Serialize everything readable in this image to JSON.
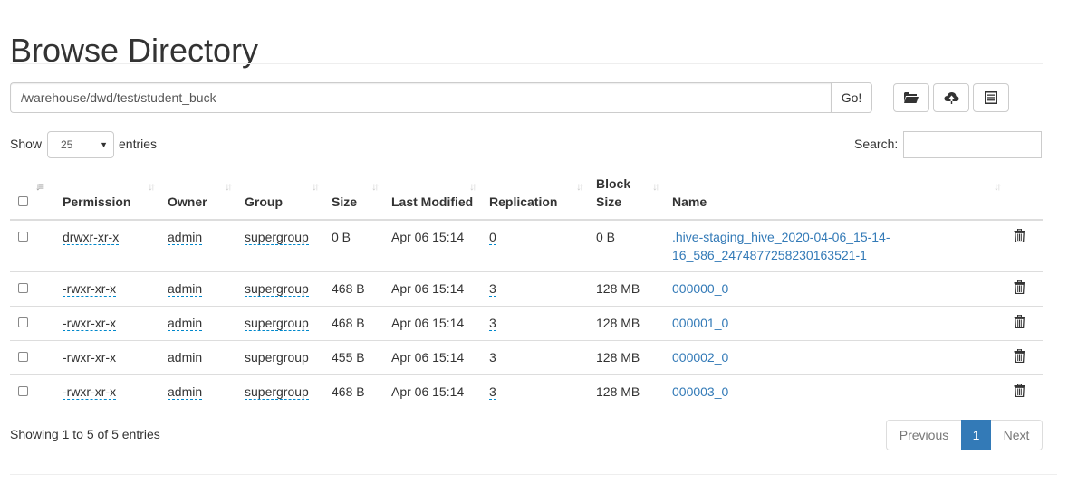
{
  "page": {
    "title": "Browse Directory"
  },
  "path_bar": {
    "value": "/warehouse/dwd/test/student_buck",
    "go_label": "Go!"
  },
  "toolbar": {
    "icons": [
      "folder-open-icon",
      "upload-icon",
      "list-icon"
    ]
  },
  "controls": {
    "show_label": "Show",
    "page_length": "25",
    "entries_label": "entries",
    "search_label": "Search:",
    "search_value": ""
  },
  "table": {
    "headers": {
      "permission": "Permission",
      "owner": "Owner",
      "group": "Group",
      "size": "Size",
      "last_modified": "Last Modified",
      "replication": "Replication",
      "block_size": "Block Size",
      "name": "Name"
    },
    "rows": [
      {
        "permission": "drwxr-xr-x",
        "owner": "admin",
        "group": "supergroup",
        "size": "0 B",
        "last_modified": "Apr 06 15:14",
        "replication": "0",
        "block_size": "0 B",
        "name": ".hive-staging_hive_2020-04-06_15-14-16_586_2474877258230163521-1"
      },
      {
        "permission": "-rwxr-xr-x",
        "owner": "admin",
        "group": "supergroup",
        "size": "468 B",
        "last_modified": "Apr 06 15:14",
        "replication": "3",
        "block_size": "128 MB",
        "name": "000000_0"
      },
      {
        "permission": "-rwxr-xr-x",
        "owner": "admin",
        "group": "supergroup",
        "size": "468 B",
        "last_modified": "Apr 06 15:14",
        "replication": "3",
        "block_size": "128 MB",
        "name": "000001_0"
      },
      {
        "permission": "-rwxr-xr-x",
        "owner": "admin",
        "group": "supergroup",
        "size": "455 B",
        "last_modified": "Apr 06 15:14",
        "replication": "3",
        "block_size": "128 MB",
        "name": "000002_0"
      },
      {
        "permission": "-rwxr-xr-x",
        "owner": "admin",
        "group": "supergroup",
        "size": "468 B",
        "last_modified": "Apr 06 15:14",
        "replication": "3",
        "block_size": "128 MB",
        "name": "000003_0"
      }
    ]
  },
  "footer": {
    "info": "Showing 1 to 5 of 5 entries",
    "prev_label": "Previous",
    "current_page": "1",
    "next_label": "Next"
  },
  "colors": {
    "link": "#337ab7",
    "active_page": "#337ab7",
    "border": "#dddddd"
  }
}
